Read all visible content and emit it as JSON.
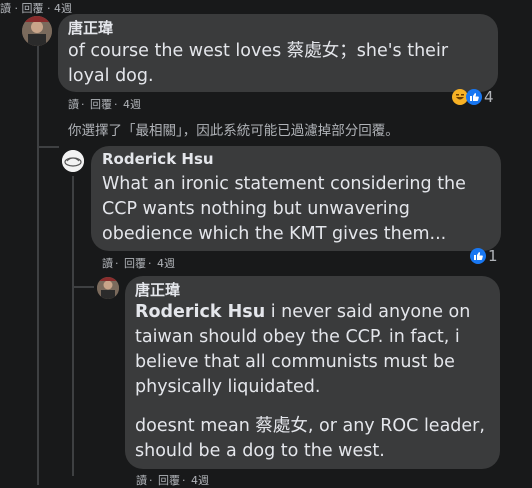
{
  "top_cut": {
    "read": "讀",
    "reply": "回覆",
    "time": "4週"
  },
  "comment1": {
    "author": "唐正瑋",
    "text_line1": "of course the west loves 蔡處女；she's their",
    "text_line2": "loyal dog.",
    "meta": {
      "read": "讀",
      "dot1": "·",
      "reply": "回覆",
      "dot2": "·",
      "time": "4週"
    },
    "reactions": {
      "count": "4",
      "icons": [
        "haha-icon",
        "like-icon"
      ]
    }
  },
  "filter_notice": "你選擇了「最相關」，因此系統可能已過濾掉部分回覆。",
  "comment2": {
    "author": "Roderick Hsu",
    "line1": "What an ironic statement considering the",
    "line2": "CCP wants nothing but unwavering",
    "line3": "obedience which the KMT gives them...",
    "meta": {
      "read": "讀",
      "dot1": "·",
      "reply": "回覆",
      "dot2": "·",
      "time": "4週"
    },
    "reactions": {
      "count": "1",
      "icons": [
        "like-icon"
      ]
    }
  },
  "comment3": {
    "author": "唐正瑋",
    "mention": "Roderick Hsu",
    "p1_line1_rest": " i never said anyone on",
    "p1_line2": "taiwan should obey the CCP. in fact, i",
    "p1_line3": "believe that all communists must be",
    "p1_line4": "physically liquidated.",
    "p2_line1": "doesnt mean 蔡處女, or any ROC leader,",
    "p2_line2": "should be a dog to the west.",
    "meta": {
      "read": "讀",
      "dot1": "·",
      "reply": "回覆",
      "dot2": "·",
      "time": "4週"
    }
  },
  "colors": {
    "background": "#18191a",
    "bubble": "#3a3b3c",
    "text": "#e4e6eb",
    "secondary": "#b0b3b8",
    "like_blue": "#1877f2",
    "haha_yellow": "#f7b125"
  }
}
